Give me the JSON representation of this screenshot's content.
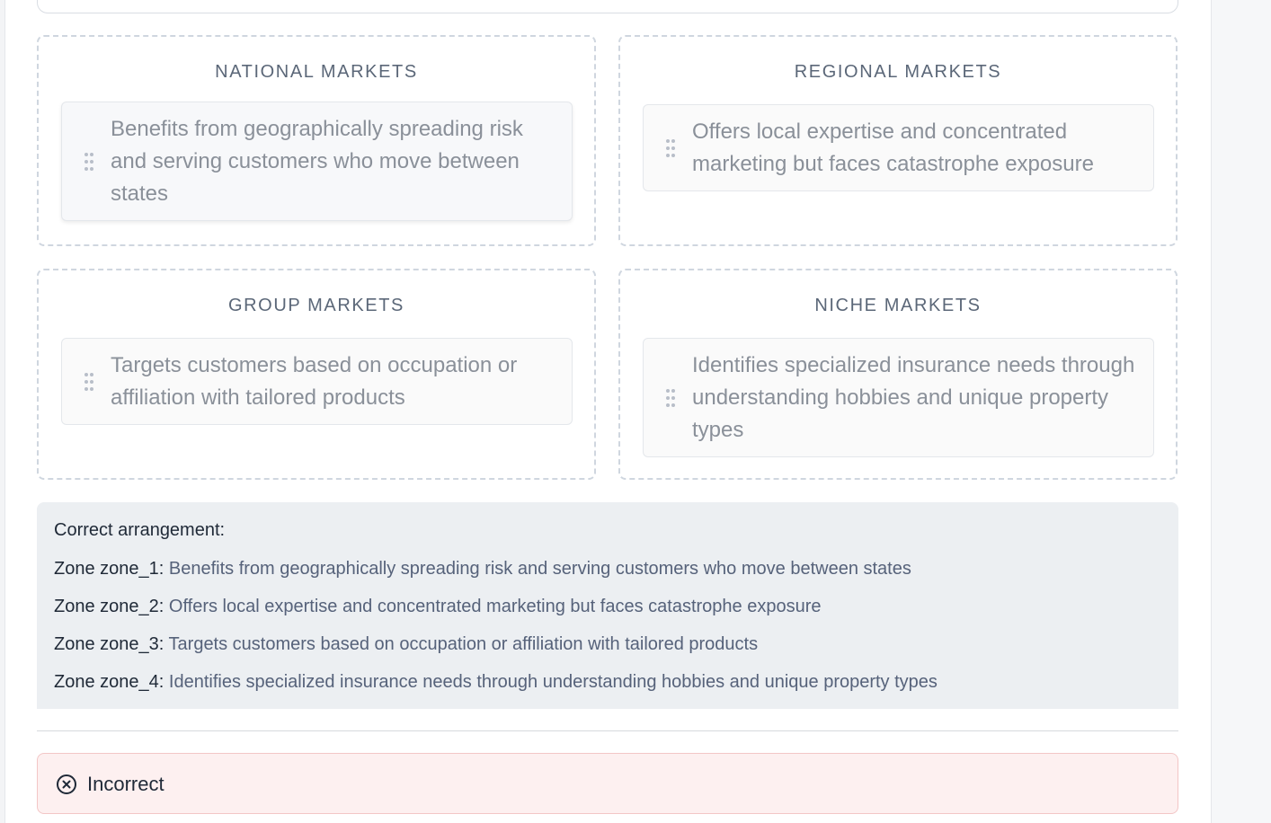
{
  "zones": [
    {
      "title": "NATIONAL MARKETS",
      "card": "Benefits from geographically spreading risk and serving customers who move between states"
    },
    {
      "title": "REGIONAL MARKETS",
      "card": "Offers local expertise and concentrated marketing but faces catastrophe exposure"
    },
    {
      "title": "GROUP MARKETS",
      "card": "Targets customers based on occupation or affiliation with tailored products"
    },
    {
      "title": "NICHE MARKETS",
      "card": "Identifies specialized insurance needs through understanding hobbies and unique property types"
    }
  ],
  "answer": {
    "heading": "Correct arrangement:",
    "lines": [
      {
        "label": "Zone zone_1:",
        "text": "Benefits from geographically spreading risk and serving customers who move between states"
      },
      {
        "label": "Zone zone_2:",
        "text": "Offers local expertise and concentrated marketing but faces catastrophe exposure"
      },
      {
        "label": "Zone zone_3:",
        "text": "Targets customers based on occupation or affiliation with tailored products"
      },
      {
        "label": "Zone zone_4:",
        "text": "Identifies specialized insurance needs through understanding hobbies and unique property types"
      }
    ]
  },
  "result": {
    "icon": "x-circle-icon",
    "label": "Incorrect",
    "color": "#fdf0f0"
  }
}
